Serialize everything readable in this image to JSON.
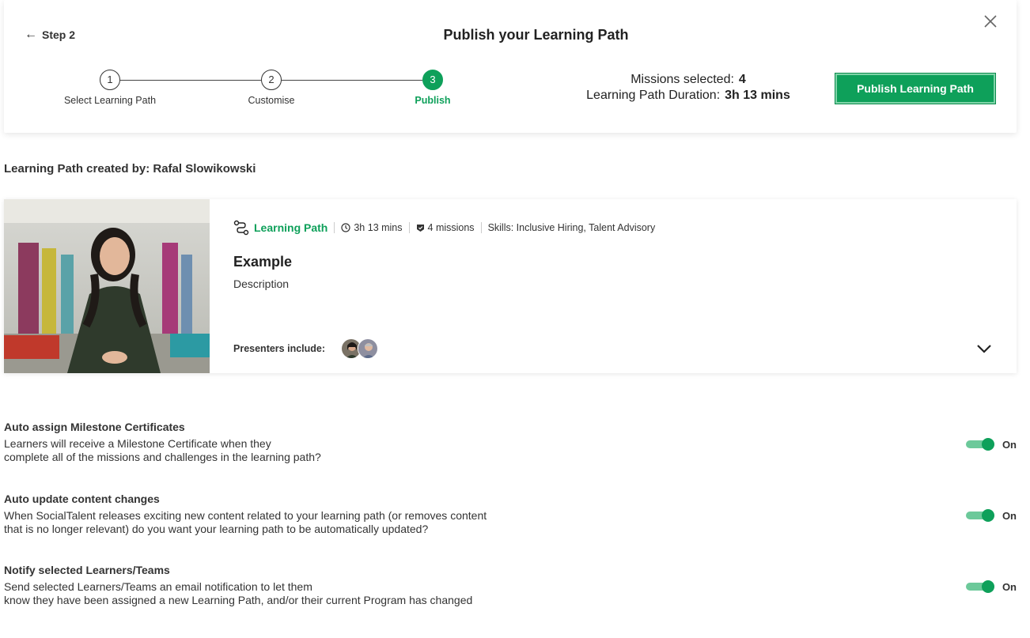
{
  "header": {
    "back_label": "Step 2",
    "title": "Publish your Learning Path",
    "publish_button": "Publish Learning Path"
  },
  "stepper": {
    "steps": [
      {
        "number": "1",
        "label": "Select Learning Path"
      },
      {
        "number": "2",
        "label": "Customise"
      },
      {
        "number": "3",
        "label": "Publish"
      }
    ],
    "active_step": 3
  },
  "summary": {
    "missions_label": "Missions selected:",
    "missions_value": "4",
    "duration_label": "Learning Path Duration:",
    "duration_value": "3h 13 mins"
  },
  "created_by": "Learning Path created by: Rafal Slowikowski",
  "card": {
    "type_label": "Learning Path",
    "duration": "3h 13 mins",
    "missions": "4 missions",
    "skills": "Skills: Inclusive Hiring, Talent Advisory",
    "title": "Example",
    "description": "Description",
    "presenters_label": "Presenters include:"
  },
  "settings": [
    {
      "title": "Auto assign Milestone Certificates",
      "desc_line1": "Learners will receive a Milestone Certificate when they",
      "desc_line2": "complete all of the missions and challenges in the learning path?",
      "toggle_label": "On",
      "enabled": true
    },
    {
      "title": "Auto update content changes",
      "desc_line1": "When SocialTalent releases exciting new content related to your learning path (or removes content",
      "desc_line2": "that is no longer relevant) do you want your learning path to be automatically updated?",
      "toggle_label": "On",
      "enabled": true
    },
    {
      "title": "Notify selected Learners/Teams",
      "desc_line1": "Send selected Learners/Teams an email notification to let them",
      "desc_line2": "know they have been assigned a new Learning Path, and/or their current Program has changed",
      "toggle_label": "On",
      "enabled": true
    }
  ],
  "colors": {
    "accent": "#0ea05a",
    "toggle_track": "#6cc99a"
  }
}
